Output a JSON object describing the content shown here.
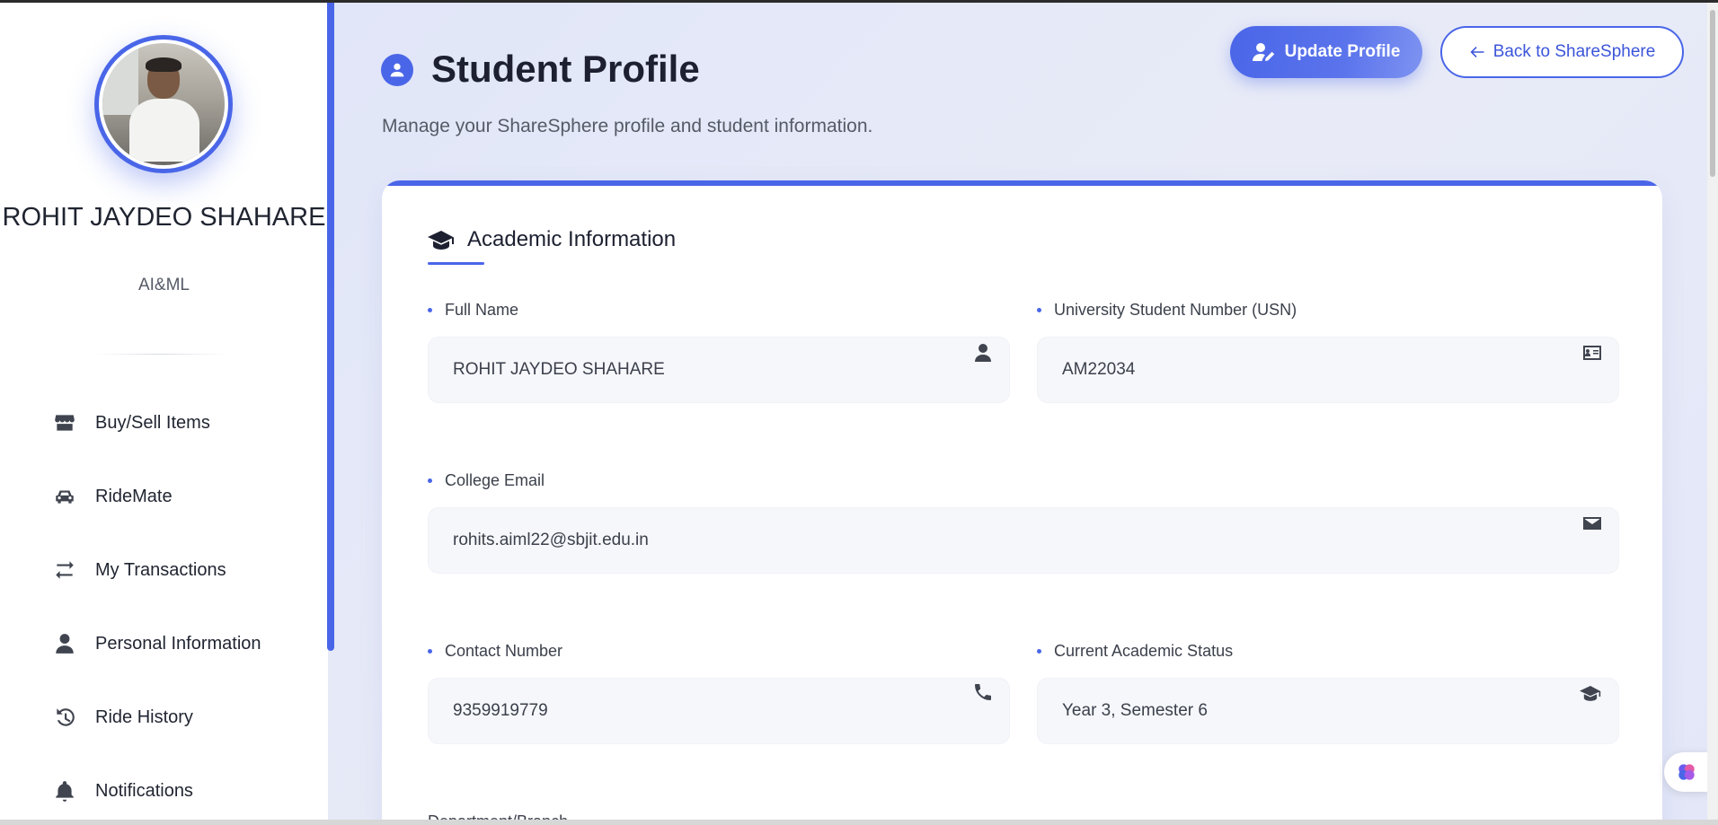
{
  "sidebar": {
    "user_name": "ROHIT JAYDEO SHAHARE",
    "department": "AI&ML",
    "items": [
      {
        "label": "Buy/Sell Items",
        "icon": "store-icon"
      },
      {
        "label": "RideMate",
        "icon": "car-icon"
      },
      {
        "label": "My Transactions",
        "icon": "exchange-icon"
      },
      {
        "label": "Personal Information",
        "icon": "user-icon"
      },
      {
        "label": "Ride History",
        "icon": "history-icon"
      },
      {
        "label": "Notifications",
        "icon": "bell-icon"
      }
    ]
  },
  "header": {
    "title": "Student Profile",
    "subtitle": "Manage your ShareSphere profile and student information.",
    "update_button": "Update Profile",
    "back_button": "Back to ShareSphere"
  },
  "academic": {
    "section_title": "Academic Information",
    "full_name_label": "Full Name",
    "full_name_value": "ROHIT JAYDEO SHAHARE",
    "usn_label": "University Student Number (USN)",
    "usn_value": "AM22034",
    "email_label": "College Email",
    "email_value": "rohits.aiml22@sbjit.edu.in",
    "contact_label": "Contact Number",
    "contact_value": "9359919779",
    "status_label": "Current Academic Status",
    "status_value": "Year 3, Semester 6",
    "next_label": "Department/Branch"
  },
  "colors": {
    "accent": "#4a66e8",
    "text": "#1c2030"
  }
}
